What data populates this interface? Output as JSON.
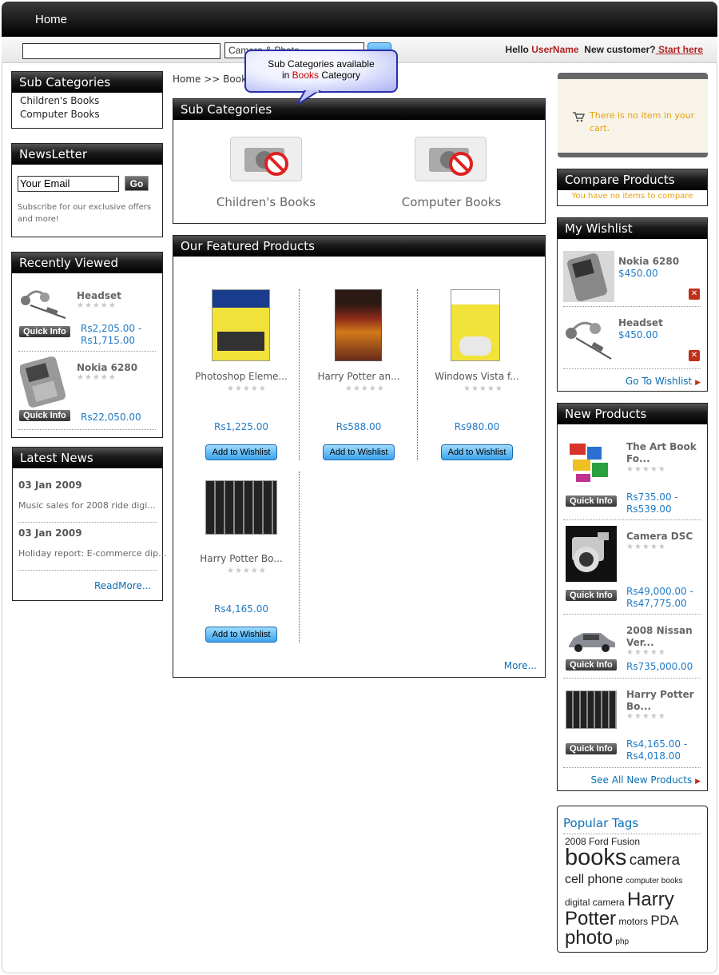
{
  "header": {
    "home": "Home"
  },
  "search": {
    "category": "Camera & Photo",
    "hello": "Hello",
    "username": "UserName",
    "new_customer": "New customer?",
    "start_here": " Start here"
  },
  "tooltip": {
    "line1": "Sub Categories available",
    "in": "in ",
    "category": "Books",
    "rest": " Category"
  },
  "breadcrumb": "Home >> Books",
  "left": {
    "subcategories": {
      "title": "Sub Categories",
      "items": [
        "Children's Books",
        "Computer Books"
      ]
    },
    "newsletter": {
      "title": "NewsLetter",
      "placeholder": "Your Email",
      "go": "Go",
      "note": "Subscribe for our exclusive offers and more!"
    },
    "recent": {
      "title": "Recently Viewed",
      "items": [
        {
          "name": "Headset",
          "price1": "Rs2,205.00 -",
          "price2": "Rs1,715.00",
          "quick": "Quick Info"
        },
        {
          "name": "Nokia 6280",
          "price1": "Rs22,050.00",
          "price2": "",
          "quick": "Quick Info"
        }
      ]
    },
    "news": {
      "title": "Latest News",
      "items": [
        {
          "date": "03 Jan 2009",
          "text": "Music sales for 2008 ride digi..."
        },
        {
          "date": "03 Jan 2009",
          "text": "Holiday report: E-commerce dip..."
        }
      ],
      "more": "ReadMore..."
    }
  },
  "center": {
    "subcats": {
      "title": "Sub Categories",
      "items": [
        "Children's Books",
        "Computer Books"
      ]
    },
    "featured": {
      "title": "Our Featured Products",
      "items": [
        {
          "name": "Photoshop Eleme...",
          "price": "Rs1,225.00",
          "button": "Add to Wishlist"
        },
        {
          "name": "Harry Potter an...",
          "price": "Rs588.00",
          "button": "Add to Wishlist"
        },
        {
          "name": "Windows Vista f...",
          "price": "Rs980.00",
          "button": "Add to Wishlist"
        },
        {
          "name": "Harry Potter Bo...",
          "price": "Rs4,165.00",
          "button": "Add to Wishlist"
        }
      ],
      "more": "More..."
    }
  },
  "right": {
    "cart": {
      "text": "There is no item in your cart."
    },
    "compare": {
      "title": "Compare Products",
      "text": "You have no items to compare"
    },
    "wishlist": {
      "title": "My Wishlist",
      "items": [
        {
          "name": "Nokia 6280",
          "price": "$450.00"
        },
        {
          "name": "Headset",
          "price": "$450.00"
        }
      ],
      "goto": "Go To Wishlist"
    },
    "newprod": {
      "title": "New Products",
      "items": [
        {
          "name": "The Art Book Fo...",
          "price1": "Rs735.00 -",
          "price2": "Rs539.00",
          "quick": "Quick Info"
        },
        {
          "name": "Camera DSC",
          "price1": "Rs49,000.00 -",
          "price2": "Rs47,775.00",
          "quick": "Quick Info"
        },
        {
          "name": "2008 Nissan Ver...",
          "price1": "Rs735,000.00",
          "price2": "",
          "quick": "Quick Info"
        },
        {
          "name": "Harry Potter Bo...",
          "price1": "Rs4,165.00 -",
          "price2": "Rs4,018.00",
          "quick": "Quick Info"
        }
      ],
      "seeall": "See All New Products"
    },
    "tags": {
      "title": "Popular Tags",
      "items": [
        "2008 Ford Fusion",
        "books",
        "camera",
        "cell phone",
        "computer books",
        "digital camera",
        "Harry Potter",
        "motors",
        "PDA",
        "photo",
        "php"
      ]
    }
  },
  "colors": {
    "accent": "#0b6fb5",
    "header": "#000000",
    "cart_text": "#e8a10c",
    "red": "#b22222"
  }
}
